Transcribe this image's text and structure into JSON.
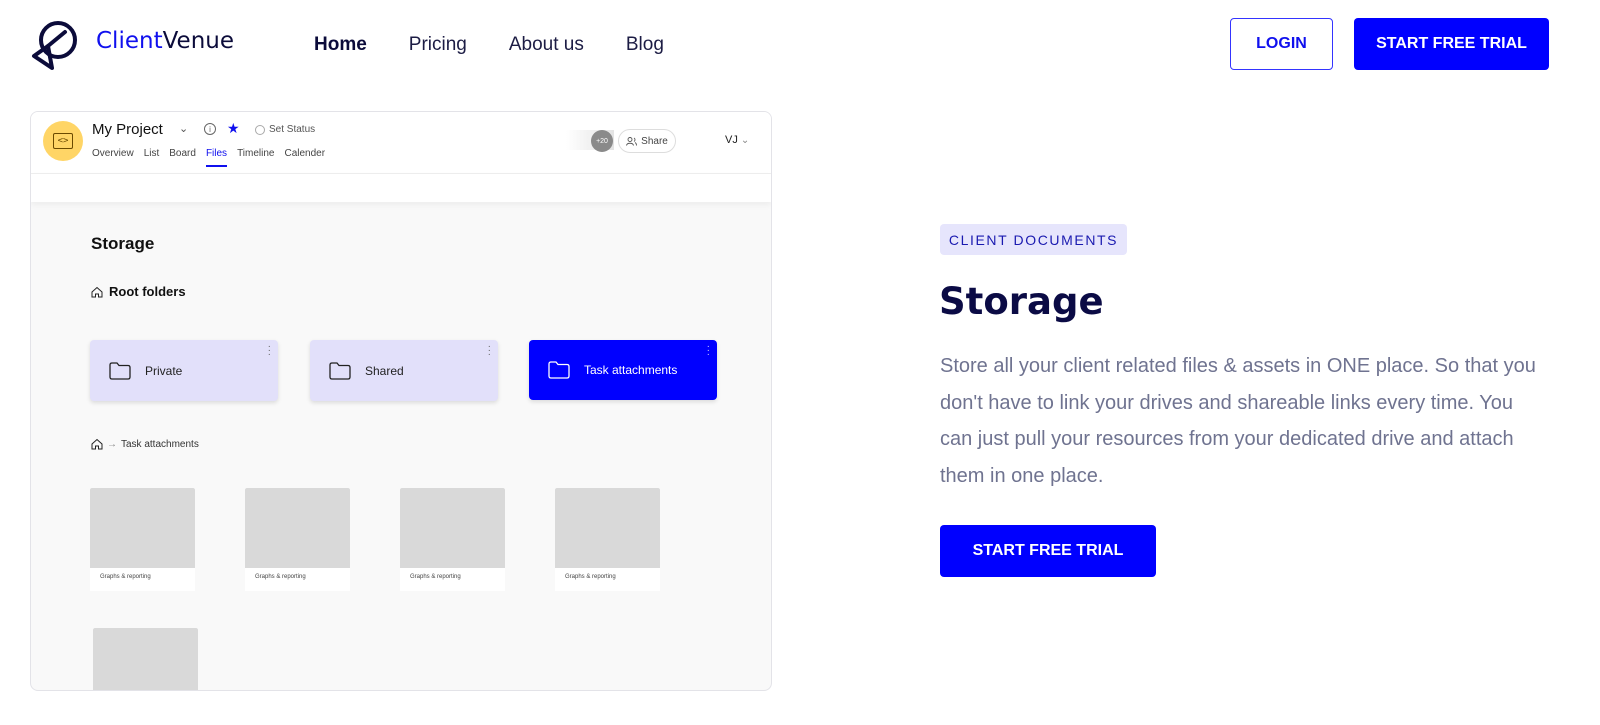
{
  "brand": {
    "name_part1": "Client",
    "name_part2": "Venue"
  },
  "nav": {
    "items": [
      "Home",
      "Pricing",
      "About us",
      "Blog"
    ],
    "active": "Home"
  },
  "header": {
    "login_label": "LOGIN",
    "trial_label": "START FREE TRIAL"
  },
  "mock": {
    "project_title": "My Project",
    "set_status": "Set Status",
    "tabs": [
      "Overview",
      "List",
      "Board",
      "Files",
      "Timeline",
      "Calender"
    ],
    "active_tab": "Files",
    "users_badge": "+20",
    "share_label": "Share",
    "user_initials": "VJ",
    "storage_heading": "Storage",
    "root_folders_label": "Root folders",
    "folders": [
      "Private",
      "Shared",
      "Task attachments"
    ],
    "selected_folder": "Task attachments",
    "breadcrumb_arrow": "→",
    "breadcrumb_current": "Task attachments",
    "thumb_caption": "Graphs & reporting"
  },
  "hero": {
    "eyebrow": "CLIENT DOCUMENTS",
    "title": "Storage",
    "description": "Store all your client related files & assets in ONE place. So that you don't have to link your drives and shareable links every time. You can just pull your resources from your dedicated drive and attach them in one place.",
    "cta_label": "START FREE TRIAL"
  },
  "colors": {
    "accent": "#0000ff",
    "navy": "#0b0b45",
    "eyebrow_bg": "#e6e5fc",
    "folder_bg": "#e2e0fa",
    "project_avatar": "#ffd566"
  },
  "icons": [
    "logo-mark-icon",
    "chevron-down-icon",
    "info-icon",
    "star-icon",
    "status-circle-icon",
    "share-users-icon",
    "home-icon",
    "folder-icon",
    "kebab-menu-icon"
  ]
}
